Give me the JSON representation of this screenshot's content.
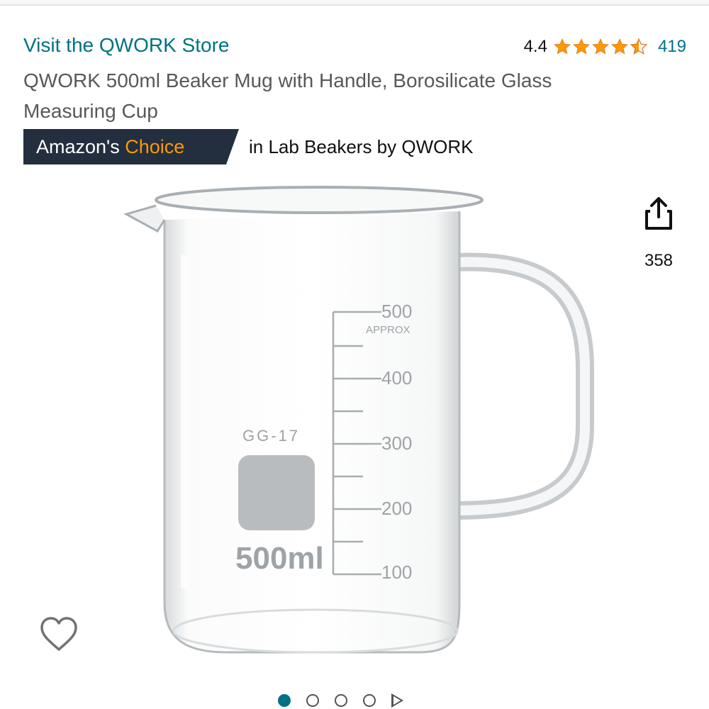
{
  "product": {
    "store_link": "Visit the QWORK Store",
    "rating_value": "4.4",
    "review_count": "419",
    "stars_filled": 4.4,
    "star_color": "#ff9900",
    "title": "QWORK 500ml Beaker Mug with Handle, Borosilicate Glass Measuring Cup"
  },
  "badge": {
    "prefix": "Amazon's",
    "accent": "Choice",
    "context": "in Lab Beakers by QWORK",
    "bg_color": "#232f3e",
    "accent_color": "#ff9900"
  },
  "image_labels": {
    "model": "GG-17",
    "capacity": "500ml",
    "approx": "APPROX",
    "scale": [
      "500",
      "400",
      "300",
      "200",
      "100"
    ]
  },
  "share": {
    "icon": "share-icon",
    "count": "358"
  },
  "wishlist": {
    "icon": "heart-icon"
  },
  "carousel": {
    "dots": 4,
    "active_index": 0,
    "has_video": true
  }
}
